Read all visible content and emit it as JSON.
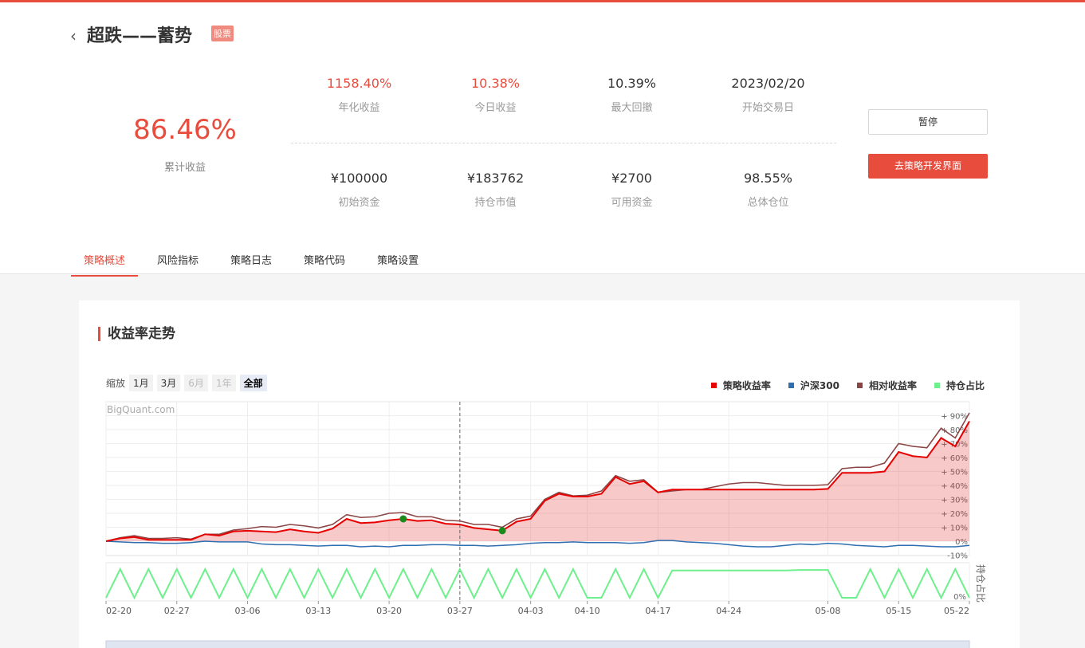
{
  "header": {
    "back_icon": "chevron-left-icon",
    "title": "超跌——蓄势",
    "badge": "股票",
    "cumulative": {
      "value": "86.46%",
      "label": "累计收益"
    },
    "metrics_top": [
      {
        "value": "1158.40%",
        "label": "年化收益",
        "color": "#e84c3d"
      },
      {
        "value": "10.38%",
        "label": "今日收益",
        "color": "#e84c3d"
      },
      {
        "value": "10.39%",
        "label": "最大回撤",
        "color": "#333333"
      },
      {
        "value": "2023/02/20",
        "label": "开始交易日",
        "color": "#333333"
      }
    ],
    "metrics_bottom": [
      {
        "value": "¥100000",
        "label": "初始资金"
      },
      {
        "value": "¥183762",
        "label": "持仓市值"
      },
      {
        "value": "¥2700",
        "label": "可用资金"
      },
      {
        "value": "98.55%",
        "label": "总体仓位"
      }
    ],
    "pause_button": "暂停",
    "dev_button": "去策略开发界面"
  },
  "tabs": [
    {
      "label": "策略概述",
      "active": true
    },
    {
      "label": "风险指标",
      "active": false
    },
    {
      "label": "策略日志",
      "active": false
    },
    {
      "label": "策略代码",
      "active": false
    },
    {
      "label": "策略设置",
      "active": false
    }
  ],
  "card": {
    "title": "收益率走势",
    "zoom_label": "缩放",
    "zoom_buttons": [
      {
        "label": "1月",
        "state": "normal"
      },
      {
        "label": "3月",
        "state": "normal"
      },
      {
        "label": "6月",
        "state": "disabled"
      },
      {
        "label": "1年",
        "state": "disabled"
      },
      {
        "label": "全部",
        "state": "selected"
      }
    ],
    "watermark": "BigQuant.com"
  },
  "chart_data": {
    "type": "line",
    "title": "",
    "legend_position": "top-right",
    "x": [
      "02-20",
      "02-21",
      "02-22",
      "02-23",
      "02-24",
      "02-27",
      "02-28",
      "03-01",
      "03-02",
      "03-03",
      "03-06",
      "03-07",
      "03-08",
      "03-09",
      "03-10",
      "03-13",
      "03-14",
      "03-15",
      "03-16",
      "03-17",
      "03-20",
      "03-21",
      "03-22",
      "03-23",
      "03-24",
      "03-27",
      "03-28",
      "03-29",
      "03-30",
      "03-31",
      "04-03",
      "04-04",
      "04-06",
      "04-07",
      "04-10",
      "04-11",
      "04-12",
      "04-13",
      "04-14",
      "04-17",
      "04-18",
      "04-19",
      "04-20",
      "04-21",
      "04-24",
      "04-25",
      "04-26",
      "04-27",
      "04-28",
      "05-04",
      "05-05",
      "05-08",
      "05-09",
      "05-10",
      "05-11",
      "05-12",
      "05-15",
      "05-16",
      "05-17",
      "05-18",
      "05-19",
      "05-22"
    ],
    "x_ticks": [
      "02-20",
      "02-27",
      "03-06",
      "03-13",
      "03-20",
      "03-27",
      "04-03",
      "04-10",
      "04-17",
      "04-24",
      "05-08",
      "05-15",
      "05-22"
    ],
    "y_ticks": [
      "+ 90%",
      "+ 80%",
      "+ 70%",
      "+ 60%",
      "+ 50%",
      "+ 40%",
      "+ 30%",
      "+ 20%",
      "+ 10%",
      "0%",
      "-10%"
    ],
    "ylim": [
      -10,
      92
    ],
    "y2_label": "持仓占比",
    "y2_ticks": [
      "0%"
    ],
    "marker_dates": [
      "03-21",
      "03-30"
    ],
    "vertical_dashed_line": "03-27",
    "series": [
      {
        "name": "策略收益率",
        "color": "#e60000",
        "values": [
          0,
          2,
          3,
          1,
          1,
          1,
          1,
          5,
          4,
          7,
          7.5,
          7,
          6.5,
          8.5,
          7,
          6,
          9,
          16,
          13,
          13.5,
          15,
          16,
          14.5,
          15,
          12.5,
          12,
          9.5,
          8.5,
          7.5,
          14,
          16,
          29,
          34,
          32,
          32,
          34,
          46,
          41,
          43,
          35,
          37,
          37,
          37,
          37,
          37,
          37,
          37,
          37,
          37,
          37,
          37,
          37.5,
          49,
          49,
          49,
          50,
          64,
          61,
          60,
          74,
          68,
          86
        ]
      },
      {
        "name": "沪深300",
        "color": "#2f6fb0",
        "values": [
          0,
          -0.5,
          -1,
          -1,
          -1.5,
          -1.5,
          -1,
          0,
          -0.5,
          -0.5,
          -0.5,
          -2,
          -2.5,
          -2.5,
          -3,
          -3.5,
          -3,
          -3,
          -4,
          -3.5,
          -4,
          -3,
          -3,
          -2.5,
          -2.5,
          -3,
          -3,
          -3.5,
          -3,
          -2.5,
          -1.5,
          -1,
          -1,
          -0.5,
          -1,
          -1,
          -1,
          -1.5,
          -1,
          0.5,
          0.5,
          -0.5,
          -1,
          -1.5,
          -2.5,
          -3.5,
          -4,
          -4,
          -3,
          -2,
          -2.5,
          -1.5,
          -2,
          -3,
          -3.5,
          -4,
          -3,
          -3,
          -3.5,
          -4,
          -4,
          -3
        ]
      },
      {
        "name": "相对收益率",
        "color": "#8b4545",
        "values": [
          0,
          2.5,
          4,
          2,
          2,
          2.5,
          1.5,
          5,
          5,
          8,
          9,
          10.5,
          10,
          12,
          11,
          9.5,
          12,
          19,
          17,
          17.5,
          20,
          20.5,
          17.5,
          17.5,
          15,
          14.5,
          12,
          12,
          10,
          16,
          18,
          30,
          35,
          32.5,
          33,
          36,
          47,
          43,
          44,
          35,
          36,
          37,
          37,
          39,
          41,
          42,
          42,
          41,
          40,
          40,
          40,
          40.5,
          52,
          53,
          53,
          56,
          70,
          68,
          67,
          81,
          74,
          92
        ]
      },
      {
        "name": "持仓占比",
        "color": "#6ef08c",
        "values": [
          0,
          1,
          0,
          1,
          0,
          1,
          0,
          1,
          0,
          1,
          0,
          1,
          0,
          1,
          0,
          1,
          0,
          1,
          0,
          1,
          0,
          1,
          0,
          1,
          0,
          1,
          0,
          1,
          0,
          1,
          0,
          1,
          0,
          1,
          0,
          0,
          1,
          0,
          1,
          0,
          0.95,
          0.95,
          0.95,
          0.95,
          0.95,
          0.95,
          0.95,
          0.95,
          0.95,
          0.97,
          0.97,
          0.97,
          0,
          0,
          1,
          0,
          1,
          0,
          1,
          0,
          1,
          0
        ]
      }
    ]
  }
}
